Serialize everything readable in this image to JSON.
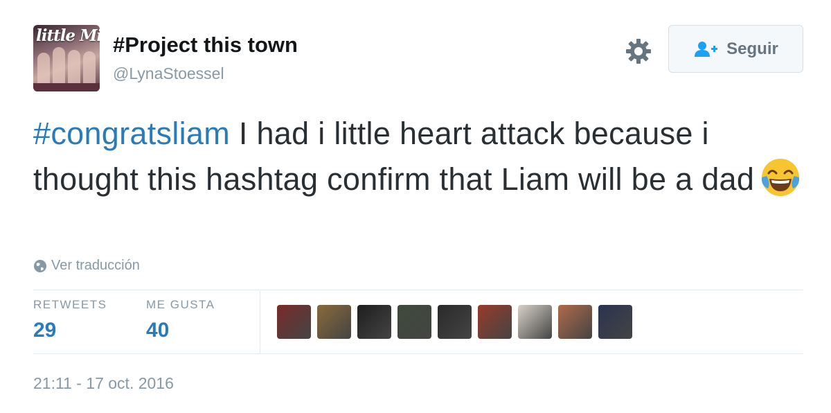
{
  "user": {
    "avatar_icon": "band-avatar-image",
    "avatar_brand_text": "little Mix",
    "fullname": "#Project this town",
    "screen_name": "@LynaStoessel"
  },
  "actions": {
    "settings_icon": "gear-icon",
    "follow_icon": "add-user-icon",
    "follow_label": "Seguir"
  },
  "tweet": {
    "hashtag": "#congratsliam",
    "text": " I had i little heart attack because i thought this hashtag confirm  that Liam will be a dad",
    "emoji": "face-with-tears-of-joy",
    "translate_label": "Ver traducción"
  },
  "stats": {
    "retweets_label": "RETWEETS",
    "retweets_count": "29",
    "likes_label": "ME GUSTA",
    "likes_count": "40"
  },
  "likers": [
    {
      "name": "liker-avatar",
      "color": "#7a2a2a"
    },
    {
      "name": "liker-avatar",
      "color": "#8a6a3a"
    },
    {
      "name": "liker-avatar",
      "color": "#1e1e1e"
    },
    {
      "name": "liker-avatar",
      "color": "#3e4a3a"
    },
    {
      "name": "liker-avatar",
      "color": "#2a2a2a"
    },
    {
      "name": "liker-avatar",
      "color": "#9a3a2a"
    },
    {
      "name": "liker-avatar",
      "color": "#d8d2c8"
    },
    {
      "name": "liker-avatar",
      "color": "#b06a4a"
    },
    {
      "name": "liker-avatar",
      "color": "#2a3450"
    }
  ],
  "timestamp": "21:11 - 17 oct. 2016",
  "colors": {
    "link_blue": "#2b7bb9",
    "muted_gray": "#8899a6",
    "text_dark": "#292f33"
  }
}
